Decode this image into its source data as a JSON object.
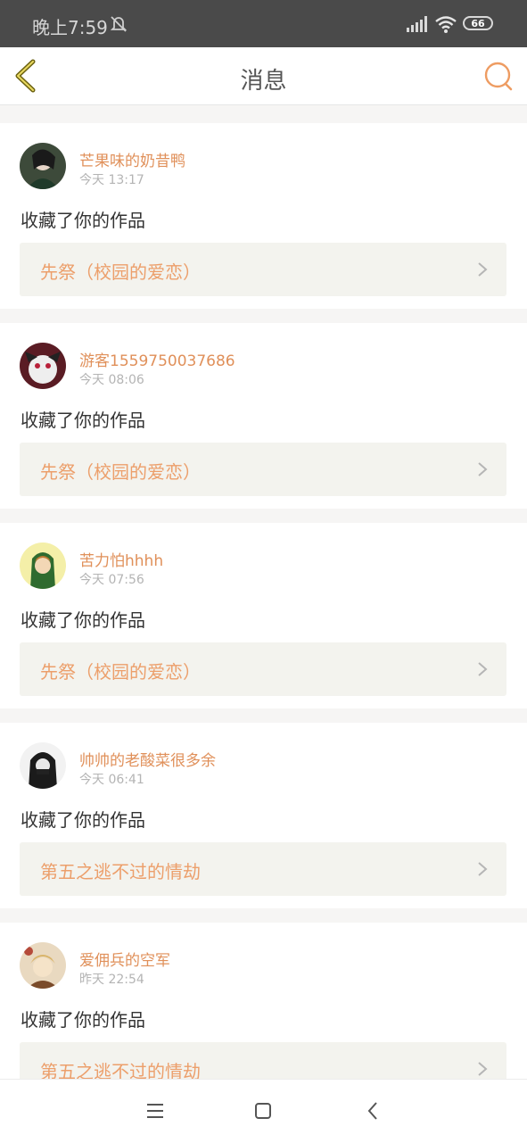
{
  "status_bar": {
    "time": "晚上7:59",
    "battery": "66"
  },
  "header": {
    "title": "消息"
  },
  "colors": {
    "accent": "#e0905a",
    "link_bg": "#f3f3ee",
    "status_bar_bg": "#4a4a4a"
  },
  "notifications": [
    {
      "username": "芒果味的奶昔鸭",
      "time": "今天 13:17",
      "action": "收藏了你的作品",
      "work": "先祭（校园的爱恋）"
    },
    {
      "username": "游客1559750037686",
      "time": "今天 08:06",
      "action": "收藏了你的作品",
      "work": "先祭（校园的爱恋）"
    },
    {
      "username": "苦力怕hhhh",
      "time": "今天 07:56",
      "action": "收藏了你的作品",
      "work": "先祭（校园的爱恋）"
    },
    {
      "username": "帅帅的老酸菜很多余",
      "time": "今天 06:41",
      "action": "收藏了你的作品",
      "work": "第五之逃不过的情劫"
    },
    {
      "username": "爱佣兵的空军",
      "time": "昨天 22:54",
      "action": "收藏了你的作品",
      "work": "第五之逃不过的情劫"
    }
  ],
  "icons": {
    "back": "back-chevron-icon",
    "search": "search-icon",
    "menu": "menu-icon",
    "home": "home-square-icon",
    "nav_back": "nav-back-icon"
  }
}
